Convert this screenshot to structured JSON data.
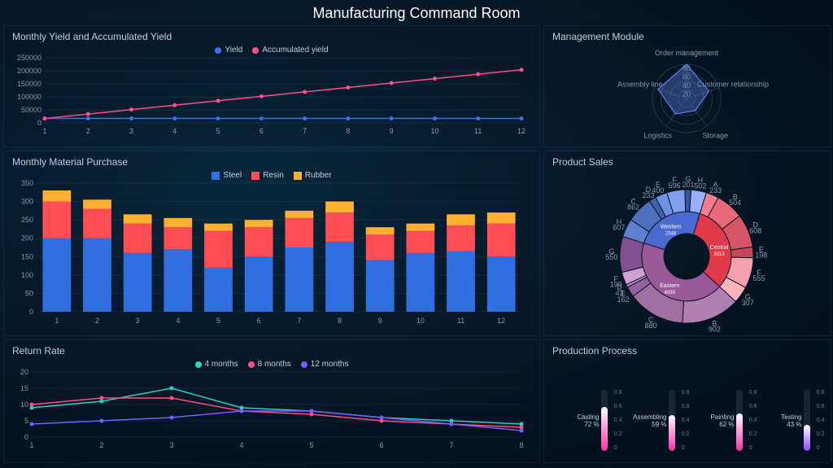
{
  "header": {
    "title": "Manufacturing Command Room"
  },
  "yield_panel": {
    "title": "Monthly Yield and Accumulated Yield",
    "legend": {
      "yield": "Yield",
      "acc": "Accumulated yield"
    }
  },
  "material_panel": {
    "title": "Monthly Material Purchase",
    "legend": {
      "steel": "Steel",
      "resin": "Resin",
      "rubber": "Rubber"
    }
  },
  "return_panel": {
    "title": "Return Rate",
    "legend": {
      "m4": "4 months",
      "m8": "8 months",
      "m12": "12 months"
    }
  },
  "radar_panel": {
    "title": "Management Module"
  },
  "sales_panel": {
    "title": "Product Sales"
  },
  "process_panel": {
    "title": "Production Process"
  },
  "chart_data": [
    {
      "id": "yield",
      "type": "line",
      "title": "Monthly Yield and Accumulated Yield",
      "x": [
        1,
        2,
        3,
        4,
        5,
        6,
        7,
        8,
        9,
        10,
        11,
        12
      ],
      "series": [
        {
          "name": "Yield",
          "values": [
            17000,
            17000,
            17000,
            17000,
            17000,
            17000,
            17000,
            17000,
            17000,
            17000,
            17000,
            17000
          ],
          "color": "#3b6cff"
        },
        {
          "name": "Accumulated yield",
          "values": [
            17000,
            34000,
            51000,
            68000,
            85000,
            102000,
            119000,
            136000,
            153000,
            170000,
            187000,
            204000
          ],
          "color": "#ff4d88"
        }
      ],
      "ylim": [
        0,
        250000
      ],
      "yticks": [
        0,
        50000,
        100000,
        150000,
        200000,
        250000
      ]
    },
    {
      "id": "material",
      "type": "bar",
      "stacked": true,
      "title": "Monthly Material Purchase",
      "categories": [
        1,
        2,
        3,
        4,
        5,
        6,
        7,
        8,
        9,
        10,
        11,
        12
      ],
      "series": [
        {
          "name": "Steel",
          "values": [
            200,
            200,
            160,
            170,
            120,
            150,
            175,
            190,
            140,
            160,
            165,
            150
          ],
          "color": "#2f6fe0"
        },
        {
          "name": "Resin",
          "values": [
            100,
            80,
            80,
            60,
            100,
            80,
            80,
            80,
            70,
            60,
            70,
            90
          ],
          "color": "#ff4d55"
        },
        {
          "name": "Rubber",
          "values": [
            30,
            25,
            25,
            25,
            20,
            20,
            20,
            30,
            20,
            20,
            30,
            30
          ],
          "color": "#ffb030"
        }
      ],
      "ylim": [
        0,
        350
      ],
      "yticks": [
        0,
        50,
        100,
        150,
        200,
        250,
        300,
        350
      ]
    },
    {
      "id": "return",
      "type": "line",
      "title": "Return Rate",
      "x": [
        1,
        2,
        3,
        4,
        5,
        6,
        7,
        8
      ],
      "series": [
        {
          "name": "4 months",
          "values": [
            9,
            11,
            15,
            9,
            8,
            6,
            5,
            4
          ],
          "color": "#1fd6c9"
        },
        {
          "name": "8 months",
          "values": [
            10,
            12,
            12,
            8,
            7,
            5,
            4,
            3
          ],
          "color": "#ff4d88"
        },
        {
          "name": "12 months",
          "values": [
            4,
            5,
            6,
            8,
            8,
            6,
            4,
            2
          ],
          "color": "#7a5cff"
        }
      ],
      "ylim": [
        0,
        20
      ],
      "yticks": [
        0,
        5,
        10,
        15,
        20
      ]
    },
    {
      "id": "radar",
      "type": "radar",
      "title": "Management Module",
      "axes": [
        "Order management",
        "Customer relationship",
        "Storage",
        "Logistics",
        "Assembly line"
      ],
      "values": [
        80,
        55,
        35,
        45,
        70
      ],
      "rings": [
        20,
        40,
        60,
        80
      ],
      "max": 80
    },
    {
      "id": "sales",
      "type": "sunburst",
      "title": "Product Sales",
      "inner": [
        {
          "name": "Central",
          "value": 3013,
          "color": "#e03a4a"
        },
        {
          "name": "Eastern",
          "value": 4039,
          "color": "#9a5a9a"
        },
        {
          "name": "Western",
          "value": 2348,
          "color": "#4a6ad0"
        }
      ],
      "outer": [
        {
          "region": "Central",
          "label": "A",
          "value": 233
        },
        {
          "region": "Central",
          "label": "B",
          "value": 504
        },
        {
          "region": "Central",
          "label": "D",
          "value": 608
        },
        {
          "region": "Central",
          "label": "E",
          "value": 198
        },
        {
          "region": "Central",
          "label": "F",
          "value": 555
        },
        {
          "region": "Central",
          "label": "G",
          "value": 307
        },
        {
          "region": "Eastern",
          "label": "B",
          "value": 902
        },
        {
          "region": "Eastern",
          "label": "C",
          "value": 880
        },
        {
          "region": "Eastern",
          "label": "E",
          "value": 162
        },
        {
          "region": "Eastern",
          "label": "D",
          "value": 43
        },
        {
          "region": "Eastern",
          "label": "F",
          "value": 199
        },
        {
          "region": "Eastern",
          "label": "G",
          "value": 550
        },
        {
          "region": "Western",
          "label": "H",
          "value": 607
        },
        {
          "region": "Western",
          "label": "C",
          "value": 862
        },
        {
          "region": "Western",
          "label": "D",
          "value": 233
        },
        {
          "region": "Western",
          "label": "E",
          "value": 400
        },
        {
          "region": "Western",
          "label": "F",
          "value": 596
        },
        {
          "region": "Western",
          "label": "G",
          "value": 201
        },
        {
          "region": "Western",
          "label": "H",
          "value": 502
        }
      ]
    },
    {
      "id": "process",
      "type": "gauge",
      "title": "Production Process",
      "items": [
        {
          "name": "Casting",
          "pct": 72,
          "color": "#ff2db0"
        },
        {
          "name": "Assembling",
          "pct": 59,
          "color": "#ff2db0"
        },
        {
          "name": "Painting",
          "pct": 62,
          "color": "#ff2db0"
        },
        {
          "name": "Testing",
          "pct": 43,
          "color": "#8a4dff"
        }
      ],
      "scale": [
        0,
        0.2,
        0.4,
        0.6,
        0.8
      ]
    }
  ]
}
